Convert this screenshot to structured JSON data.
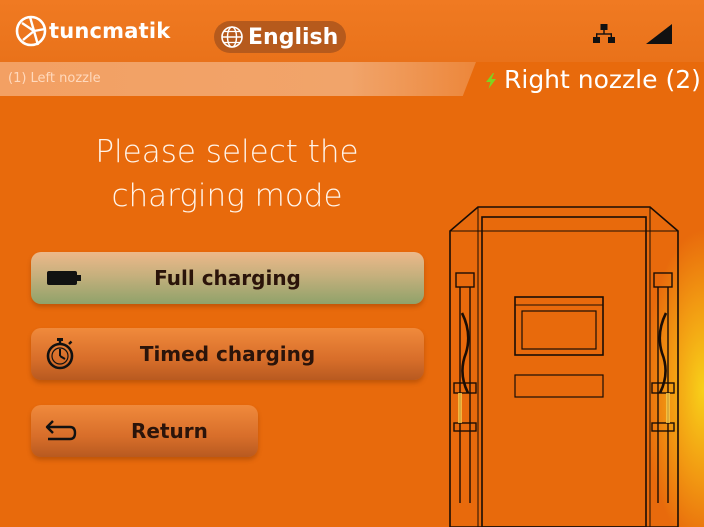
{
  "brand": {
    "name": "tuncmatik",
    "logo_icon": "tuncmatik-logo-icon"
  },
  "language": {
    "label": "English",
    "icon": "globe-icon"
  },
  "status_icons": [
    "network-icon",
    "signal-icon"
  ],
  "tabs": {
    "left": {
      "label": "(1) Left nozzle"
    },
    "right": {
      "label": "Right nozzle (2)",
      "icon": "lightning-bolt-icon"
    }
  },
  "prompt": {
    "line1": "Please select the",
    "line2": "charging mode"
  },
  "buttons": {
    "full": {
      "label": "Full charging",
      "icon": "battery-icon"
    },
    "timed": {
      "label": "Timed charging",
      "icon": "stopwatch-icon"
    },
    "return": {
      "label": "Return",
      "icon": "return-arrow-icon"
    }
  },
  "colors": {
    "background": "#e86a0c",
    "accent_yellow": "#f8d21a",
    "bolt_green": "#7ed321",
    "full_button_green": "#8fa26a"
  }
}
